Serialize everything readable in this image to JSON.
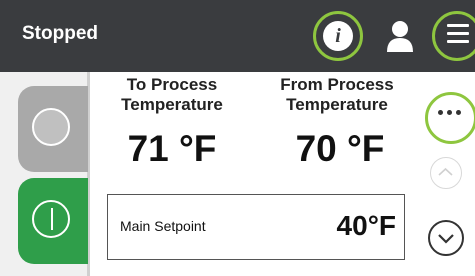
{
  "header": {
    "status": "Stopped",
    "icons": {
      "info": "info-icon",
      "user": "user-icon",
      "menu": "menu-icon"
    }
  },
  "main": {
    "to_process": {
      "label": "To Process Temperature",
      "label_line1": "To Process",
      "label_line2": "Temperature",
      "value": "71 °F"
    },
    "from_process": {
      "label": "From Process Temperature",
      "label_line1": "From Process",
      "label_line2": "Temperature",
      "value": "70 °F"
    },
    "setpoint": {
      "label": "Main Setpoint",
      "value": "40°F"
    }
  },
  "controls": {
    "more": "more-options",
    "scroll_up": "chevron-up-icon",
    "scroll_down": "chevron-down-icon"
  },
  "colors": {
    "header_bg": "#3a3c3f",
    "highlight_ring": "#8ec63f",
    "run_green": "#2f9e4a",
    "stop_gray": "#a9a9a9"
  }
}
